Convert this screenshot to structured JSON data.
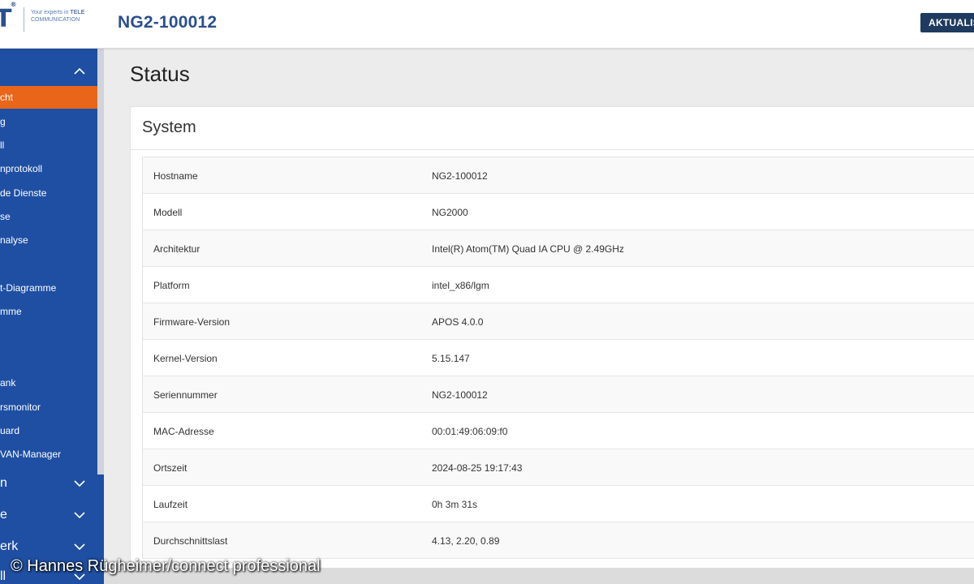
{
  "header": {
    "logo_mark": "T",
    "logo_sup": "®",
    "logo_tag_line1": "Your experts in ",
    "logo_tag_bold": "TELE",
    "logo_tag_line2": "COMMUNICATION",
    "device_name": "NG2-100012",
    "update_button": "AKTUALIS"
  },
  "sidebar": {
    "top_group_chevron": "chevron-up-icon",
    "items": [
      {
        "label": "cht",
        "active": true
      },
      {
        "label": "g",
        "active": false
      },
      {
        "label": "ll",
        "active": false
      },
      {
        "label": "nprotokoll",
        "active": false
      },
      {
        "label": "de Dienste",
        "active": false
      },
      {
        "label": "se",
        "active": false
      },
      {
        "label": "nalyse",
        "active": false
      },
      {
        "label": "t-Diagramme",
        "active": false
      },
      {
        "label": "mme",
        "active": false
      },
      {
        "label": "ank",
        "active": false
      },
      {
        "label": "rsmonitor",
        "active": false
      },
      {
        "label": "uard",
        "active": false
      },
      {
        "label": "VAN-Manager",
        "active": false
      }
    ],
    "groups": [
      {
        "label": "n",
        "icon": "chevron-down-icon"
      },
      {
        "label": "e",
        "icon": "chevron-down-icon"
      },
      {
        "label": "erk",
        "icon": "chevron-down-icon"
      },
      {
        "label": "ll",
        "icon": "chevron-down-icon"
      }
    ],
    "colors": {
      "background": "#1f4fa3",
      "active": "#e8651a"
    }
  },
  "main": {
    "page_title": "Status",
    "card_title": "System",
    "rows": [
      {
        "key": "Hostname",
        "value": "NG2-100012"
      },
      {
        "key": "Modell",
        "value": "NG2000"
      },
      {
        "key": "Architektur",
        "value": "Intel(R) Atom(TM) Quad IA CPU @ 2.49GHz"
      },
      {
        "key": "Platform",
        "value": "intel_x86/lgm"
      },
      {
        "key": "Firmware-Version",
        "value": "APOS 4.0.0"
      },
      {
        "key": "Kernel-Version",
        "value": "5.15.147"
      },
      {
        "key": "Seriennummer",
        "value": "NG2-100012"
      },
      {
        "key": "MAC-Adresse",
        "value": "00:01:49:06:09:f0"
      },
      {
        "key": "Ortszeit",
        "value": "2024-08-25 19:17:43"
      },
      {
        "key": "Laufzeit",
        "value": "0h 3m 31s"
      },
      {
        "key": "Durchschnittslast",
        "value": "4.13, 2.20, 0.89"
      }
    ]
  },
  "credit": "© Hannes Rügheimer/connect professional"
}
